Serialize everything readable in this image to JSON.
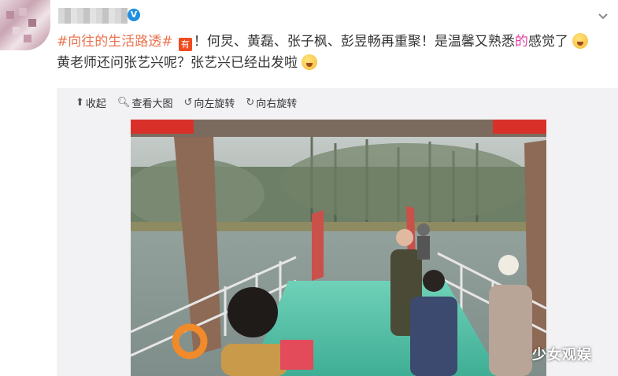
{
  "post": {
    "verified_badge": "V",
    "hashtag": "#向往的生活路透#",
    "tag_icon": "有",
    "text_part1": "！何炅、黄磊、张子枫、彭昱畅再重聚！是温馨又熟悉",
    "text_highlight": "的",
    "text_part2": "感觉了",
    "text_part3": "黄老师还问张艺兴呢？张艺兴已经出发啦",
    "emoji_1": "shushing-face",
    "emoji_2": "laughing-face"
  },
  "toolbar": {
    "collapse": "收起",
    "view_large": "查看大图",
    "rotate_left": "向左旋转",
    "rotate_right": "向右旋转"
  },
  "image": {
    "watermark": "少女观娱",
    "subject": "ferry-deck-photo"
  },
  "colors": {
    "hashtag": "#eb7350",
    "highlight": "#e03ca0",
    "media_bg": "#f2f2f5"
  }
}
